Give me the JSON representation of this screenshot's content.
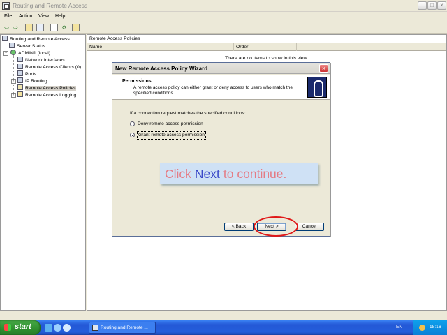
{
  "window": {
    "title": "Routing and Remote Access",
    "controls": [
      "_",
      "□",
      "×"
    ]
  },
  "menu": [
    "File",
    "Action",
    "View",
    "Help"
  ],
  "toolbar": {
    "icons": [
      "back-arrow-icon",
      "forward-arrow-icon",
      "up-folder-icon",
      "show-hide-tree-icon",
      "properties-icon",
      "refresh-icon",
      "export-list-icon"
    ]
  },
  "tree": {
    "root": "Routing and Remote Access",
    "items": [
      "Server Status",
      "ADMIN1 (local)",
      "Network Interfaces",
      "Remote Access Clients (0)",
      "Ports",
      "IP Routing",
      "Remote Access Policies",
      "Remote Access Logging"
    ],
    "selected": "Remote Access Policies"
  },
  "right_pane": {
    "header": "Remote Access Policies",
    "columns": [
      "Name",
      "Order"
    ],
    "empty_message": "There are no items to show in this view."
  },
  "dialog": {
    "title": "New Remote Access Policy Wizard",
    "heading": "Permissions",
    "description": "A remote access policy can either grant or deny access to users who match the specified conditions.",
    "prompt": "If a connection request matches the specified conditions:",
    "options": [
      {
        "label": "Deny remote access permission",
        "checked": false
      },
      {
        "label": "Grant remote access permission",
        "checked": true
      }
    ],
    "buttons": {
      "back": "< Back",
      "next": "Next >",
      "cancel": "Cancel"
    }
  },
  "callout": {
    "part1": "Click",
    "part2": "Next",
    "part3": "to continue.",
    "colors": {
      "text": "#e57b84",
      "highlight": "#3a48c8",
      "background": "#cfe1f5"
    }
  },
  "annotation": {
    "ring_color": "#e01818",
    "target": "Next >"
  },
  "taskbar": {
    "start": "start",
    "task_button": "Routing and Remote ...",
    "language": "EN",
    "clock": "18:16"
  }
}
